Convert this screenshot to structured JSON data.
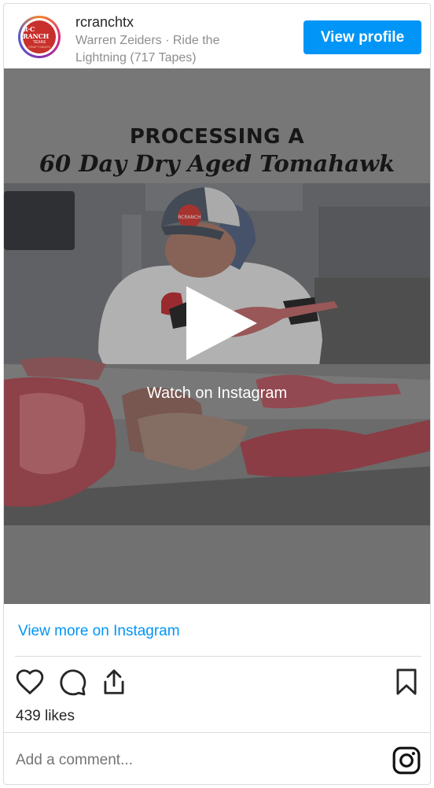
{
  "header": {
    "username": "rcranchtx",
    "subtitle": "Warren Zeiders · Ride the Lightning (717 Tapes)",
    "view_profile_label": "View profile",
    "avatar_logo_lines": [
      "R·C RANCH",
      "TEXAS",
      "CRAFT MEATS"
    ]
  },
  "media": {
    "title_line1": "PROCESSING A",
    "title_line2": "60 Day Dry Aged Tomahawk",
    "hat_patch_text": "RCRANCH",
    "watch_label": "Watch on Instagram"
  },
  "footer": {
    "more_link": "View more on Instagram",
    "likes": "439 likes",
    "comment_placeholder": "Add a comment..."
  },
  "icons": [
    "heart-icon",
    "comment-icon",
    "share-icon",
    "bookmark-icon",
    "instagram-icon",
    "play-icon"
  ],
  "colors": {
    "accent": "#0095f6",
    "text": "#262626",
    "muted": "#8e8e8e",
    "border": "#dbdbdb"
  }
}
